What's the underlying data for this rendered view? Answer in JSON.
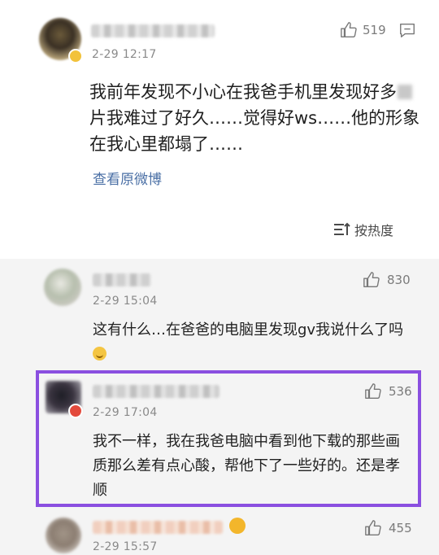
{
  "post": {
    "like_count": "519",
    "time": "2-29 12:17",
    "text_before_mask": "我前年发现不小心在我爸手机里发现好多",
    "text_after_mask": "片我难过了好久……觉得好ws……他的形象在我心里都塌了……",
    "view_original": "查看原微博",
    "sort_label": "按热度"
  },
  "replies": [
    {
      "like_count": "830",
      "time": "2-29 15:04",
      "text": "这有什么…在爸爸的电脑里发现gv我说什么了吗"
    },
    {
      "like_count": "536",
      "time": "2-29 17:04",
      "text": "我不一样，我在我爸电脑中看到他下载的那些画质那么差有点心酸，帮他下了一些好的。还是孝顺"
    },
    {
      "like_count": "455",
      "time": "2-29 15:57"
    }
  ],
  "colors": {
    "highlight": "#8a4fe0",
    "link": "#4a6fa5"
  }
}
